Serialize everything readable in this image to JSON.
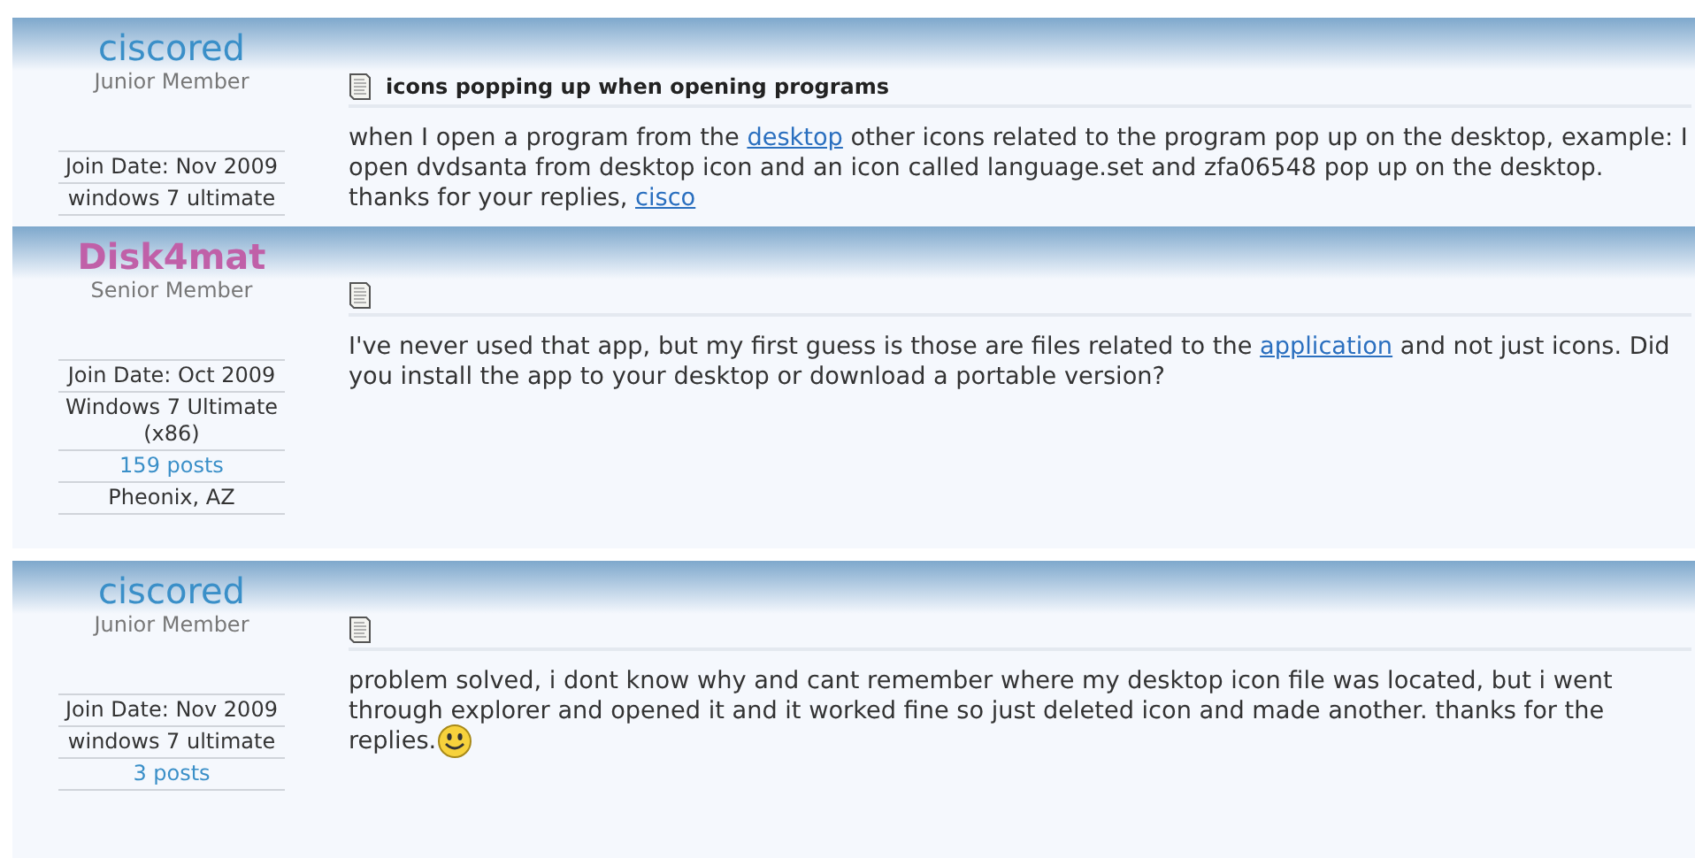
{
  "posts": [
    {
      "username": "ciscored",
      "color": "#3a8fc8",
      "bold": false,
      "rank": "Junior Member",
      "title": "icons popping up when opening programs",
      "info": [
        {
          "kind": "text",
          "text": "Join Date: Nov 2009"
        },
        {
          "kind": "text",
          "text": "windows 7 ultimate"
        }
      ],
      "body": [
        {
          "kind": "text",
          "text": "when I open a program from the "
        },
        {
          "kind": "link",
          "text": "desktop"
        },
        {
          "kind": "text",
          "text": " other icons related to the program pop up on the desktop, example: I open dvdsanta from desktop icon and an icon called language.set and zfa06548 pop up on the desktop. thanks for your replies, "
        },
        {
          "kind": "link",
          "text": "cisco"
        }
      ]
    },
    {
      "username": "Disk4mat",
      "color": "#c060a8",
      "bold": true,
      "rank": "Senior Member",
      "info": [
        {
          "kind": "text",
          "text": "Join Date: Oct 2009"
        },
        {
          "kind": "text",
          "text": "Windows 7 Ultimate (x86)"
        },
        {
          "kind": "link",
          "text": "159 posts"
        },
        {
          "kind": "text",
          "text": "Pheonix, AZ"
        }
      ],
      "body": [
        {
          "kind": "text",
          "text": "I've never used that app, but my first guess is those are files related to the "
        },
        {
          "kind": "link",
          "text": "application"
        },
        {
          "kind": "text",
          "text": " and not just icons. Did you install the app to your desktop or download a portable version?"
        }
      ]
    },
    {
      "username": "ciscored",
      "color": "#3a8fc8",
      "bold": false,
      "rank": "Junior Member",
      "info": [
        {
          "kind": "text",
          "text": "Join Date: Nov 2009"
        },
        {
          "kind": "text",
          "text": "windows 7 ultimate"
        },
        {
          "kind": "link",
          "text": "3 posts"
        }
      ],
      "body": [
        {
          "kind": "text",
          "text": "problem solved, i dont know why and cant remember where my desktop icon file was located, but i went through explorer and opened it and it worked fine so just deleted icon and made another. thanks for the replies."
        },
        {
          "kind": "smiley"
        }
      ]
    }
  ]
}
